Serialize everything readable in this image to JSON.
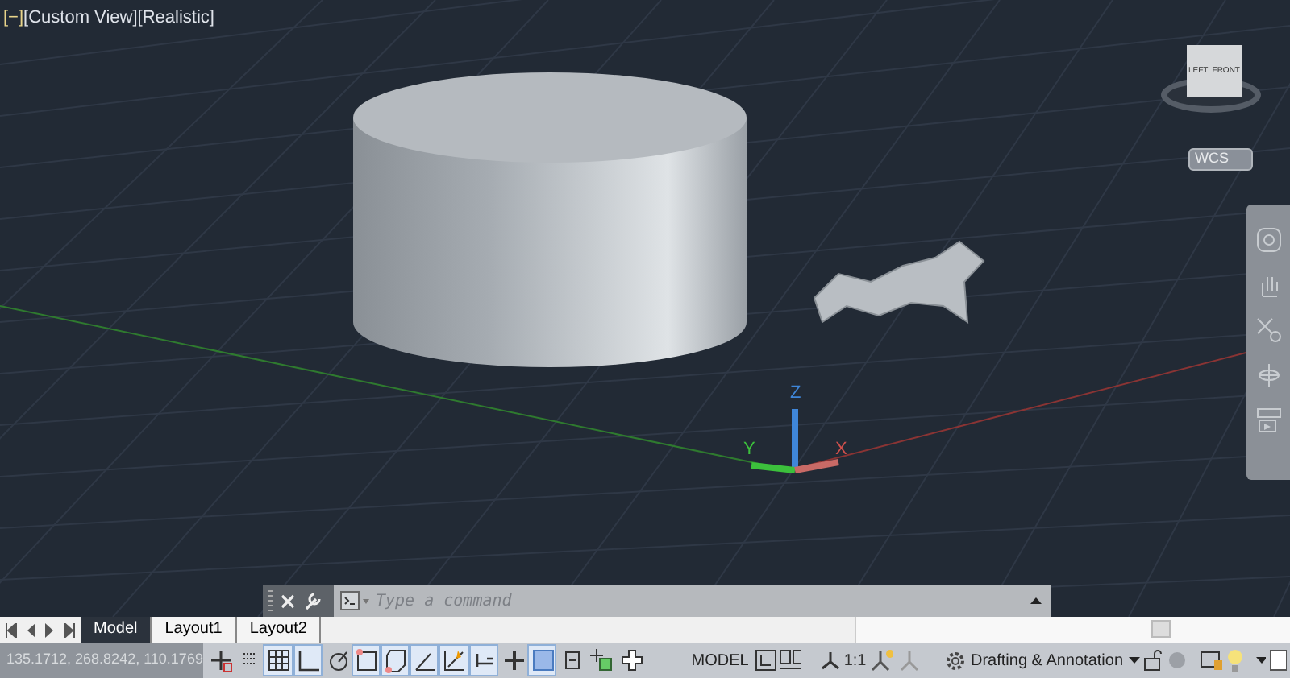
{
  "viewport": {
    "label": [
      "[−]",
      "[Custom View]",
      "[Realistic]"
    ],
    "viewcube": {
      "faces": [
        "LEFT",
        "FRONT"
      ]
    },
    "ucs_menu": "WCS",
    "axes": [
      "X",
      "Y",
      "Z"
    ]
  },
  "command_line": {
    "placeholder": "Type a command"
  },
  "layout_tabs": [
    {
      "label": "Model",
      "selected": true
    },
    {
      "label": "Layout1",
      "selected": false
    },
    {
      "label": "Layout2",
      "selected": false
    }
  ],
  "status_bar": {
    "coordinates": "135.1712, 268.8242, 110.1769",
    "toggles": [
      {
        "kind": "infer",
        "on": false
      },
      {
        "kind": "snap",
        "on": false
      },
      {
        "kind": "grid",
        "on": true
      },
      {
        "kind": "ortho",
        "on": true
      },
      {
        "kind": "polar",
        "on": false
      },
      {
        "kind": "osnap3d",
        "on": true
      },
      {
        "kind": "osnap",
        "on": true
      },
      {
        "kind": "angle",
        "on": true
      },
      {
        "kind": "track",
        "on": true
      },
      {
        "kind": "ducs",
        "on": true
      },
      {
        "kind": "dyn",
        "on": false
      },
      {
        "kind": "transparency",
        "on": true
      },
      {
        "kind": "selection",
        "on": false
      },
      {
        "kind": "gizmo",
        "on": false
      },
      {
        "kind": "plus",
        "on": false
      }
    ],
    "space": "MODEL",
    "scale": "1:1",
    "workspace": "Drafting & Annotation"
  }
}
